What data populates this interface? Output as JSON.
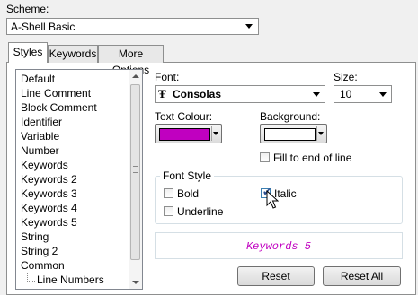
{
  "scheme": {
    "label": "Scheme:",
    "value": "A-Shell Basic"
  },
  "tabs": [
    {
      "label": "Styles",
      "active": true
    },
    {
      "label": "Keywords",
      "active": false
    },
    {
      "label": "More Options",
      "active": false
    }
  ],
  "styles_list": {
    "items": [
      "Default",
      "Line Comment",
      "Block Comment",
      "Identifier",
      "Variable",
      "Number",
      "Keywords",
      "Keywords 2",
      "Keywords 3",
      "Keywords 4",
      "Keywords 5",
      "String",
      "String 2",
      "Common",
      "Line Numbers"
    ],
    "selected": "Keywords 5"
  },
  "font": {
    "label": "Font:",
    "value": "Consolas",
    "icon": "truetype-icon"
  },
  "size": {
    "label": "Size:",
    "value": "10"
  },
  "text_colour": {
    "label": "Text Colour:",
    "color": "#c000c0"
  },
  "background": {
    "label": "Background:",
    "color": "#ffffff"
  },
  "fill_to_end": {
    "label": "Fill to end of line",
    "checked": false
  },
  "font_style": {
    "legend": "Font Style",
    "bold": {
      "label": "Bold",
      "checked": false
    },
    "italic": {
      "label": "Italic",
      "checked": true
    },
    "underline": {
      "label": "Underline",
      "checked": false
    }
  },
  "preview": {
    "text": "Keywords 5"
  },
  "buttons": {
    "reset": "Reset",
    "reset_all": "Reset All"
  }
}
